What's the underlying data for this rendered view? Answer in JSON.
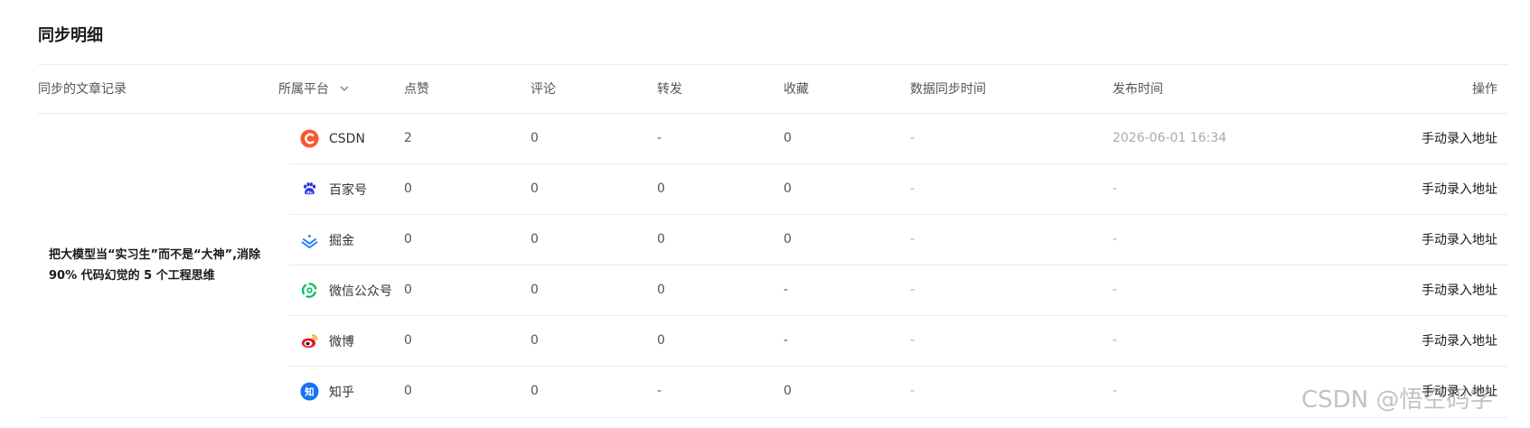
{
  "section": {
    "title": "同步明细"
  },
  "columns": {
    "article": "同步的文章记录",
    "platform": "所属平台",
    "likes": "点赞",
    "comments": "评论",
    "shares": "转发",
    "favorites": "收藏",
    "sync_time": "数据同步时间",
    "publish_time": "发布时间",
    "actions": "操作"
  },
  "article": {
    "title": "把大模型当“实习生”而不是“大神”,消除 90% 代码幻觉的 5 个工程思维"
  },
  "rows": [
    {
      "platform": "CSDN",
      "icon": "csdn-icon",
      "likes": "2",
      "comments": "0",
      "shares": "-",
      "favorites": "0",
      "sync_time": "-",
      "publish_time": "2026-06-01 16:34",
      "action": "手动录入地址"
    },
    {
      "platform": "百家号",
      "icon": "baijiahao-icon",
      "likes": "0",
      "comments": "0",
      "shares": "0",
      "favorites": "0",
      "sync_time": "-",
      "publish_time": "-",
      "action": "手动录入地址"
    },
    {
      "platform": "掘金",
      "icon": "juejin-icon",
      "likes": "0",
      "comments": "0",
      "shares": "0",
      "favorites": "0",
      "sync_time": "-",
      "publish_time": "-",
      "action": "手动录入地址"
    },
    {
      "platform": "微信公众号",
      "icon": "wechat-icon",
      "likes": "0",
      "comments": "0",
      "shares": "0",
      "favorites": "-",
      "sync_time": "-",
      "publish_time": "-",
      "action": "手动录入地址"
    },
    {
      "platform": "微博",
      "icon": "weibo-icon",
      "likes": "0",
      "comments": "0",
      "shares": "0",
      "favorites": "-",
      "sync_time": "-",
      "publish_time": "-",
      "action": "手动录入地址"
    },
    {
      "platform": "知乎",
      "icon": "zhihu-icon",
      "likes": "0",
      "comments": "0",
      "shares": "-",
      "favorites": "0",
      "sync_time": "-",
      "publish_time": "-",
      "action": "手动录入地址"
    }
  ],
  "icons": {
    "zhihu_glyph": "知"
  },
  "colors": {
    "csdn": "#fc5531",
    "baijiahao": "#2932e1",
    "juejin": "#1e80ff",
    "wechat": "#07c160",
    "weibo": "#e6162d",
    "zhihu": "#1772f6"
  },
  "watermark": "CSDN @悟空码字"
}
